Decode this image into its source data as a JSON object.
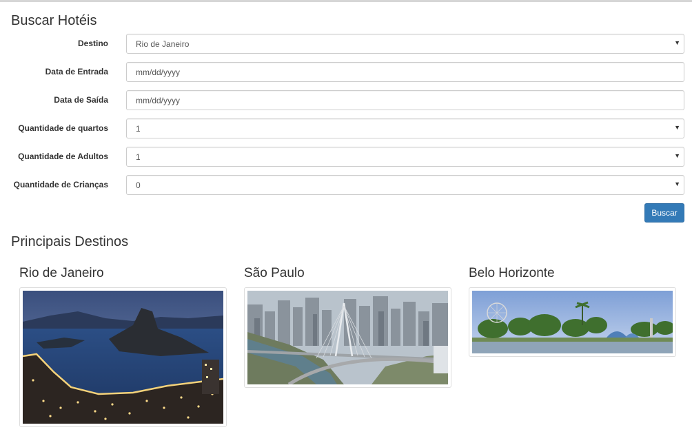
{
  "search": {
    "heading": "Buscar Hotéis",
    "destination": {
      "label": "Destino",
      "value": "Rio de Janeiro"
    },
    "checkin": {
      "label": "Data de Entrada",
      "placeholder": "mm/dd/yyyy"
    },
    "checkout": {
      "label": "Data de Saída",
      "placeholder": "mm/dd/yyyy"
    },
    "rooms": {
      "label": "Quantidade de quartos",
      "value": "1"
    },
    "adults": {
      "label": "Quantidade de Adultos",
      "value": "1"
    },
    "children": {
      "label": "Quantidade de Crianças",
      "value": "0"
    },
    "submit_label": "Buscar",
    "dropdown_icon": "caret-down",
    "button_color": "#337ab7"
  },
  "destinations": {
    "heading": "Principais Destinos",
    "items": [
      {
        "name": "Rio de Janeiro",
        "image": "rio-de-janeiro-night-bay-photo"
      },
      {
        "name": "São Paulo",
        "image": "sao-paulo-bridge-skyline-photo"
      },
      {
        "name": "Belo Horizonte",
        "image": "belo-horizonte-pampulha-lake-photo"
      }
    ]
  }
}
